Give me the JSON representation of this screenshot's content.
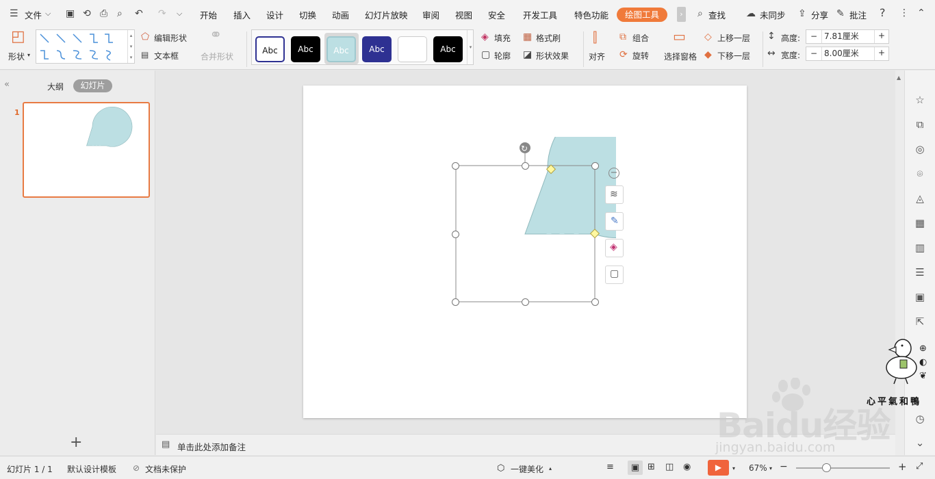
{
  "menu": {
    "file": "文件",
    "tabs": [
      "开始",
      "插入",
      "设计",
      "切换",
      "动画",
      "幻灯片放映",
      "审阅",
      "视图",
      "安全",
      "开发工具",
      "特色功能"
    ],
    "active_tab": "绘图工具",
    "search": "查找",
    "sync": "未同步",
    "share": "分享",
    "comment": "批注"
  },
  "ribbon": {
    "shape": "形状",
    "edit_shape": "编辑形状",
    "textbox": "文本框",
    "merge_shape": "合并形状",
    "style_labels": [
      "Abc",
      "Abc",
      "Abc",
      "Abc",
      "",
      "Abc"
    ],
    "fill": "填充",
    "format_painter": "格式刷",
    "outline": "轮廓",
    "shape_effect": "形状效果",
    "align": "对齐",
    "group": "组合",
    "rotate": "旋转",
    "selection_pane": "选择窗格",
    "bring_forward": "上移一层",
    "send_backward": "下移一层",
    "height_label": "高度:",
    "height_value": "7.81厘米",
    "width_label": "宽度:",
    "width_value": "8.00厘米",
    "colors": {
      "fill": "#bcdfe3",
      "accent": "#f07a3a",
      "dark_blue": "#2e3192"
    }
  },
  "left": {
    "outline_tab": "大纲",
    "slides_tab": "幻灯片",
    "slide_number": "1"
  },
  "notes_placeholder": "单击此处添加备注",
  "status": {
    "slide_info": "幻灯片 1 / 1",
    "template": "默认设计模板",
    "protect": "文档未保护",
    "beautify": "一键美化",
    "zoom": "67%"
  },
  "watermark": {
    "sticker_text": "心平氣和鴨",
    "brand": "Baidu经验",
    "url": "jingyan.baidu.com"
  }
}
